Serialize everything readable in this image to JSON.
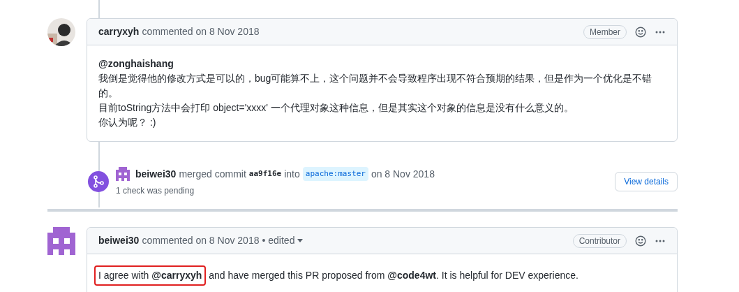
{
  "comments": [
    {
      "author": "carryxyh",
      "action": "commented on 8 Nov 2018",
      "edited": false,
      "role": "Member",
      "kind": "person",
      "body": [
        {
          "segments": [
            {
              "text": "@zonghaishang",
              "highlight": false
            }
          ]
        },
        {
          "segments": [
            {
              "text": "我倒是觉得他的修改方式是可以的，bug可能算不上，这个问题并不会导致程序出现不符合预期的结果，但是作为一个优化是不错的。",
              "highlight": false
            }
          ]
        },
        {
          "segments": [
            {
              "text": "目前toString方法中会打印 object='xxxx' 一个代理对象这种信息，但是其实这个对象的信息是没有什么意义的。",
              "highlight": false
            }
          ]
        },
        {
          "segments": [
            {
              "text": "你认为呢？ :)",
              "highlight": false
            }
          ]
        }
      ]
    },
    {
      "author": "beiwei30",
      "action": "commented on 8 Nov 2018",
      "edited": true,
      "edited_label": "• edited",
      "role": "Contributor",
      "kind": "identicon",
      "body": [
        {
          "segments": [
            {
              "text": "I agree with **@carryxyh**",
              "highlight": true
            },
            {
              "text": "and have merged this PR proposed from **@code4wt**. It is helpful for DEV experience.",
              "highlight": false
            }
          ]
        }
      ]
    }
  ],
  "merge_event": {
    "author": "beiwei30",
    "verb": "merged commit",
    "commit": "aa9f16e",
    "into": "into",
    "branch": "apache:master",
    "date": "on 8 Nov 2018",
    "status": "1 check was pending",
    "button": "View details"
  }
}
